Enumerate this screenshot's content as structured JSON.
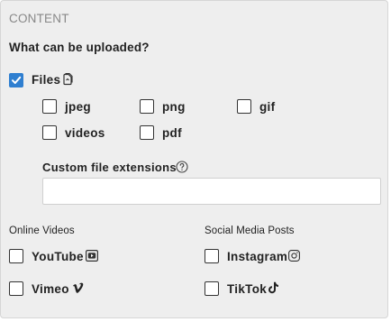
{
  "section_label": "CONTENT",
  "question": "What can be uploaded?",
  "files": {
    "label": "Files",
    "checked": true
  },
  "file_types": [
    {
      "label": "jpeg",
      "checked": false
    },
    {
      "label": "png",
      "checked": false
    },
    {
      "label": "gif",
      "checked": false
    },
    {
      "label": "videos",
      "checked": false
    },
    {
      "label": "pdf",
      "checked": false
    }
  ],
  "custom_extensions": {
    "label": "Custom file extensions",
    "value": "",
    "placeholder": ""
  },
  "online_videos": {
    "title": "Online Videos",
    "items": [
      {
        "label": "YouTube",
        "icon": "youtube-icon",
        "checked": false
      },
      {
        "label": "Vimeo",
        "icon": "vimeo-icon",
        "checked": false
      }
    ]
  },
  "social_media": {
    "title": "Social Media Posts",
    "items": [
      {
        "label": "Instagram",
        "icon": "instagram-icon",
        "checked": false
      },
      {
        "label": "TikTok",
        "icon": "tiktok-icon",
        "checked": false
      }
    ]
  },
  "colors": {
    "accent": "#2f7fd0",
    "panel_bg": "#eeeeee",
    "muted_text": "#888888"
  }
}
